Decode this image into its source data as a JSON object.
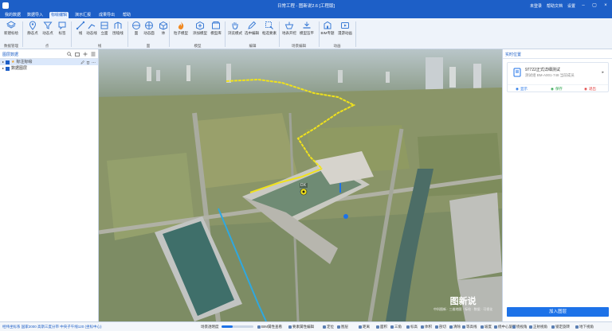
{
  "app": {
    "title": "日常工程 - 图新说2.6 [工程版]",
    "user": "未登录",
    "help": "帮助文档",
    "settings": "设置"
  },
  "menu": {
    "tabs": [
      "我的数据",
      "数据导入",
      "标绘编辑",
      "演示汇报",
      "成果导出",
      "帮助"
    ],
    "active": 2
  },
  "ribbon": {
    "buttons": [
      {
        "label": "新建标绘",
        "icon": "layers-icon"
      },
      {
        "label": "静态点",
        "icon": "pin-icon"
      },
      {
        "label": "动态点",
        "icon": "funnel-icon"
      },
      {
        "label": "标签",
        "icon": "tag-icon"
      },
      {
        "label": "线",
        "icon": "line-icon"
      },
      {
        "label": "动态线",
        "icon": "dynamic-line-icon"
      },
      {
        "label": "立面",
        "icon": "facade-icon"
      },
      {
        "label": "围墙线",
        "icon": "wall-icon"
      },
      {
        "label": "面",
        "icon": "polygon-icon"
      },
      {
        "label": "动态面",
        "icon": "dynamic-polygon-icon"
      },
      {
        "label": "体",
        "icon": "cube-icon"
      },
      {
        "label": "粒子模型",
        "icon": "fire-icon"
      },
      {
        "label": "添加模型",
        "icon": "add-model-icon"
      },
      {
        "label": "模型库",
        "icon": "model-library-icon"
      },
      {
        "label": "浏览模式",
        "icon": "hand-icon"
      },
      {
        "label": "选中编辑",
        "icon": "edit-icon"
      },
      {
        "label": "框选要素",
        "icon": "select-icon"
      },
      {
        "label": "地表开挖",
        "icon": "excavate-icon"
      },
      {
        "label": "模型压平",
        "icon": "flatten-icon"
      },
      {
        "label": "BIM专题",
        "icon": "bim-icon"
      },
      {
        "label": "漫游动画",
        "icon": "roam-icon"
      }
    ],
    "groups": [
      "数据管理",
      "点",
      "线",
      "面",
      "模型",
      "编辑",
      "场景编辑",
      "动画"
    ]
  },
  "left_panel": {
    "title": "图层数据",
    "tree": [
      {
        "label": "标注标绘",
        "selected": true,
        "checked": true
      },
      {
        "label": "数据图层",
        "selected": false,
        "checked": true
      }
    ]
  },
  "viewport": {
    "marker_label": "DX",
    "watermark": "图新说",
    "watermark_sub": "中科图新 · 三维地图 · 标绘 · 数据 · 可视化"
  },
  "right_panel": {
    "title": "实时位置",
    "card_name": "97722正式详细测试",
    "card_sub": "测试组 BM-A001-748  当前成员",
    "actions": [
      {
        "label": "显示",
        "color": "#1d72e8"
      },
      {
        "label": "保存",
        "color": "#2ea44f"
      },
      {
        "label": "退出",
        "color": "#e03a3a"
      }
    ],
    "add_button": "加入图层"
  },
  "status": {
    "coords": "经纬坐标系 国家2000 高斯三度分带 中央子午线120  (坐标中心)",
    "scene_label": "场景透明度",
    "scene_level": 0.35,
    "items": [
      "BIM属性查看",
      "要素属性编辑",
      "定位",
      "图层",
      "距离",
      "面积",
      "三角",
      "标高",
      "体积",
      "剖切",
      "清除",
      "等高线",
      "坡度",
      "绕中心旋转",
      "绕视角",
      "正射视角",
      "锁定旋转",
      "地下视角"
    ]
  }
}
